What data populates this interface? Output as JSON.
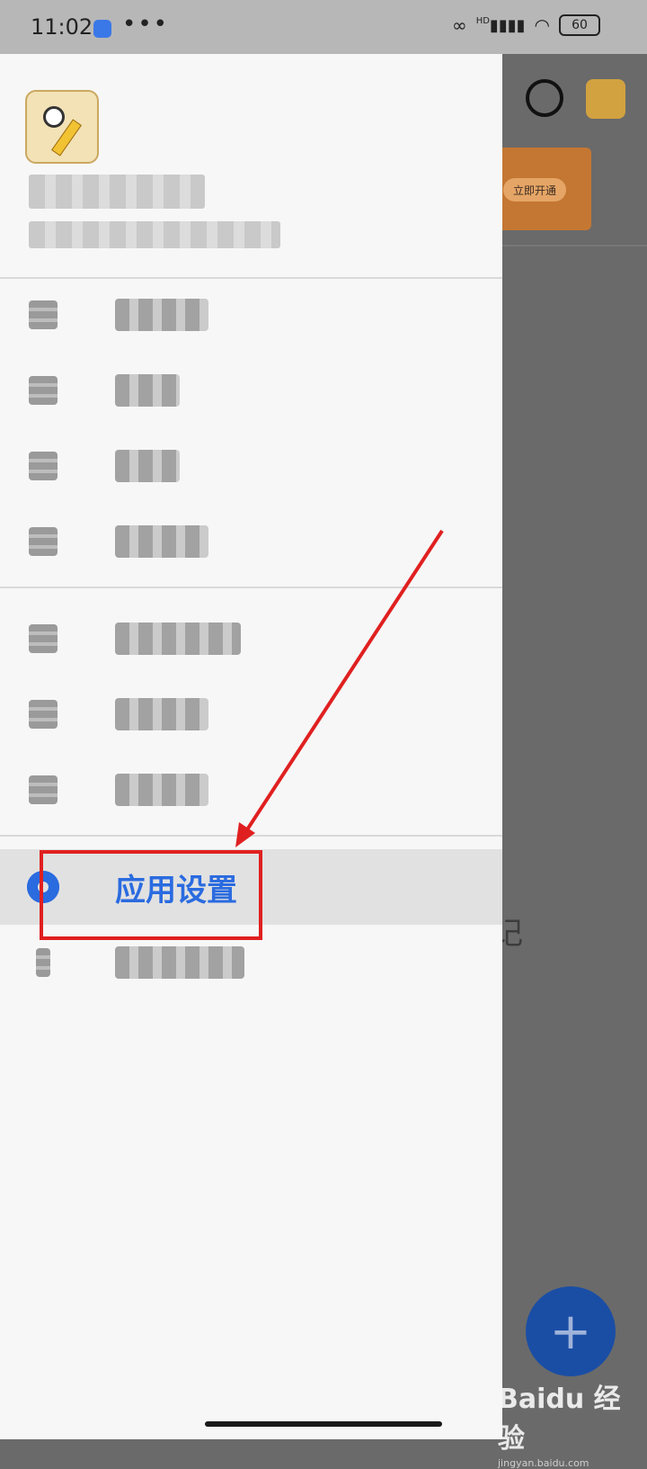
{
  "status_bar": {
    "time": "11:02",
    "more": "•••",
    "hd_label": "HD",
    "battery": "60"
  },
  "background_app": {
    "banner_button": "立即开通",
    "partial_text": "记",
    "fab_label": "+"
  },
  "drawer": {
    "selected_item": "应用设置"
  },
  "watermark": {
    "brand": "Baidu 经验",
    "url": "jingyan.baidu.com"
  },
  "colors": {
    "accent": "#2a6be0",
    "annotation": "#e02020",
    "fab": "#1a4ea5"
  }
}
